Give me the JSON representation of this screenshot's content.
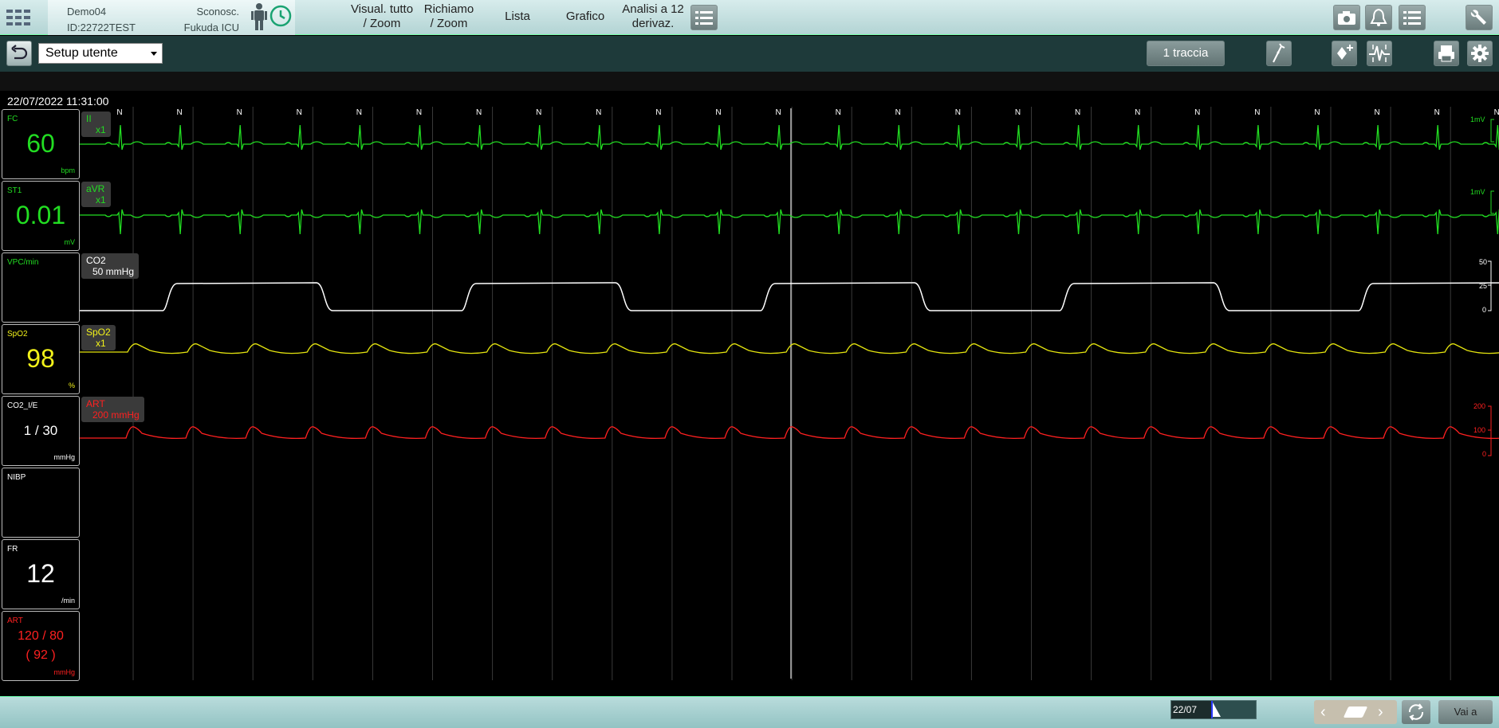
{
  "header": {
    "patient_name": "Demo04",
    "patient_id": "ID:22722TEST",
    "gender": "Sconosc.",
    "unit": "Fukuda ICU",
    "nav": [
      {
        "line1": "Visual. tutto",
        "line2": "/ Zoom"
      },
      {
        "line1": "Richiamo",
        "line2": "/ Zoom"
      },
      {
        "line1": "Lista",
        "line2": ""
      },
      {
        "line1": "Grafico",
        "line2": ""
      },
      {
        "line1": "Analisi a 12",
        "line2": "derivaz."
      }
    ]
  },
  "toolbar": {
    "setup_value": "Setup utente",
    "trace_label": "1 traccia"
  },
  "datetime": "22/07/2022 11:31:00",
  "params": [
    {
      "label": "FC",
      "value": "60",
      "unit": "bpm",
      "color": "#22dd22"
    },
    {
      "label": "ST1",
      "value": "0.01",
      "unit": "mV",
      "color": "#22dd22"
    },
    {
      "label": "VPC/min",
      "value": "",
      "unit": "",
      "color": "#22dd22"
    },
    {
      "label": "SpO2",
      "value": "98",
      "unit": "%",
      "color": "#f2f21a"
    },
    {
      "label": "CO2_I/E",
      "value": "1 / 30",
      "unit": "mmHg",
      "color": "#ffffff"
    },
    {
      "label": "NIBP",
      "value": "",
      "unit": "",
      "color": "#ffffff"
    },
    {
      "label": "FR",
      "value": "12",
      "unit": "/min",
      "color": "#ffffff"
    },
    {
      "label": "ART",
      "value": "120 / 80",
      "value2": "( 92 )",
      "unit": "mmHg",
      "color": "#ff2020"
    }
  ],
  "waves": {
    "ecg_II": {
      "lead": "II",
      "gain": "x1",
      "scale": "1mV"
    },
    "ecg_aVR": {
      "lead": "aVR",
      "gain": "x1",
      "scale": "1mV"
    },
    "co2": {
      "name": "CO2",
      "range": "50 mmHg",
      "ticks": [
        "50",
        "25",
        "0"
      ]
    },
    "spo2": {
      "name": "SpO2",
      "gain": "x1"
    },
    "art": {
      "name": "ART",
      "range": "200 mmHg",
      "ticks": [
        "200",
        "100",
        "0"
      ]
    },
    "beat_marker": "N"
  },
  "bottom": {
    "date": "22/07",
    "goto_label": "Vai a"
  },
  "colors": {
    "ecg": "#22dd22",
    "co2": "#ffffff",
    "spo2": "#e6e60f",
    "art": "#ff2020"
  }
}
